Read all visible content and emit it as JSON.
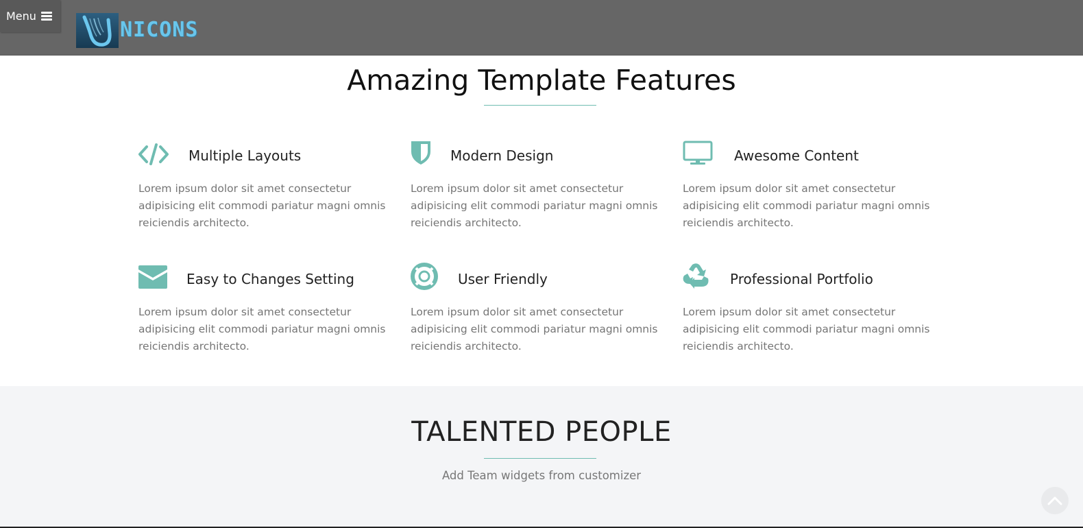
{
  "header": {
    "menu_label": "Menu",
    "menu_icon": "hamburger-icon",
    "logo_text": "NICONS",
    "logo_mark_letter": "U",
    "background": "#666666",
    "logo_color": "#69c6ec"
  },
  "features": {
    "title": "Amazing Template Features",
    "accent_color": "#6fbcb1",
    "items": [
      {
        "title": "Multiple Layouts",
        "icon": "code-icon",
        "text": "Lorem ipsum dolor sit amet consectetur adipisicing elit commodi pariatur magni omnis reiciendis architecto."
      },
      {
        "title": "Modern Design",
        "icon": "shield-icon",
        "text": "Lorem ipsum dolor sit amet consectetur adipisicing elit commodi pariatur magni omnis reiciendis architecto."
      },
      {
        "title": "Awesome Content",
        "icon": "desktop-icon",
        "text": "Lorem ipsum dolor sit amet consectetur adipisicing elit commodi pariatur magni omnis reiciendis architecto."
      },
      {
        "title": "Easy to Changes Setting",
        "icon": "envelope-icon",
        "text": "Lorem ipsum dolor sit amet consectetur adipisicing elit commodi pariatur magni omnis reiciendis architecto."
      },
      {
        "title": "User Friendly",
        "icon": "life-ring-icon",
        "text": "Lorem ipsum dolor sit amet consectetur adipisicing elit commodi pariatur magni omnis reiciendis architecto."
      },
      {
        "title": "Professional Portfolio",
        "icon": "recycle-icon",
        "text": "Lorem ipsum dolor sit amet consectetur adipisicing elit commodi pariatur magni omnis reiciendis architecto."
      }
    ]
  },
  "team": {
    "title": "TALENTED PEOPLE",
    "subtitle": "Add Team widgets from customizer"
  },
  "scroll_top": {
    "icon": "chevron-up-icon"
  }
}
